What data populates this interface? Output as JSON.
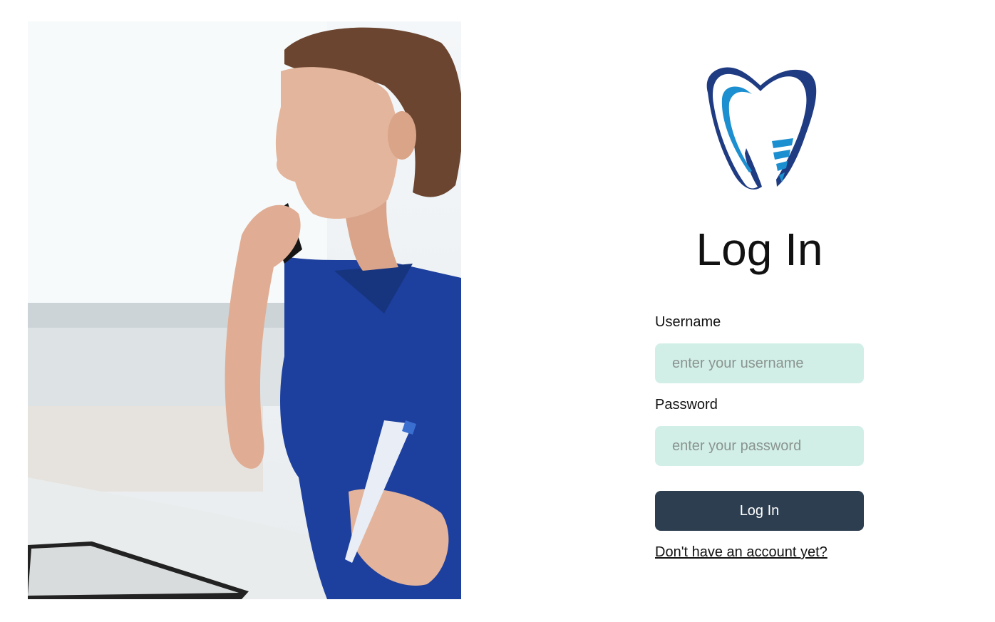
{
  "photo": {
    "description_icon": "receptionist-on-phone-photo"
  },
  "logo": {
    "icon": "tooth-implant-logo",
    "colors": {
      "outer": "#1f3b82",
      "inner": "#1c8fd0"
    }
  },
  "login": {
    "title": "Log In",
    "username_label": "Username",
    "username_placeholder": "enter your username",
    "username_value": "",
    "password_label": "Password",
    "password_placeholder": "enter your password",
    "password_value": "",
    "submit_label": "Log In",
    "signup_link": "Don't have an account yet?"
  },
  "colors": {
    "input_bg": "#d2efe7",
    "button_bg": "#2d3e50",
    "button_text": "#ffffff"
  }
}
